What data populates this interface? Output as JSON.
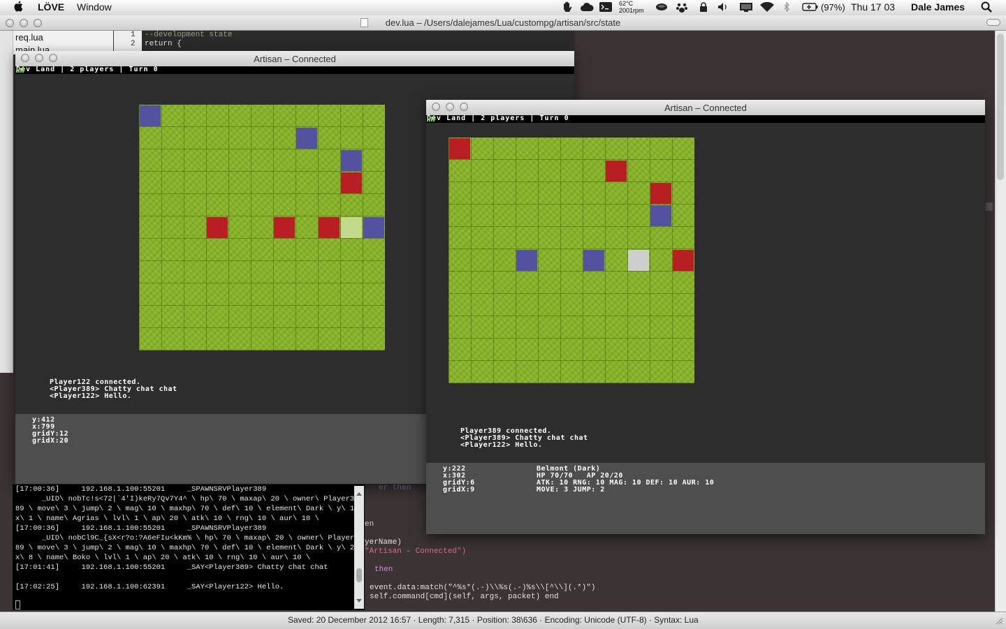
{
  "menubar": {
    "app": "LÖVE",
    "menu_window": "Window",
    "temp": "62°C",
    "rpm": "2001rpm",
    "battery": "(97%)",
    "clock": "Thu 17 03",
    "user": "Dale James"
  },
  "editor": {
    "title": "dev.lua – /Users/dalejames/Lua/custompg/artisan/src/state",
    "files": [
      "req.lua",
      "main.lua"
    ],
    "line_numbers": [
      "1",
      "2"
    ],
    "code_top": [
      "--development state",
      "return {"
    ],
    "code_bottom": [
      {
        "text": "er then",
        "color": "#7b6fa6"
      },
      {
        "text": "en",
        "color": "#cfcfcf"
      },
      {
        "text": "yerName)",
        "color": "#e0e0e0"
      },
      {
        "text": "\"Artisan – Connected\")",
        "color": "#e06c8c"
      },
      {
        "text": "then",
        "color": "#cf8cd6"
      },
      {
        "text": "event.data:match(\"^%s*(.-)\\\\%s(.-)%s\\\\[^\\\\](.*)\")",
        "color": "#e0e0e0"
      },
      {
        "text": "self.command[cmd](self, args, packet) end",
        "color": "#e0e0e0"
      }
    ],
    "status": "Saved: 20 December 2012 16:57  ·  Length: 7,315  ·  Position: 38\\636  ·  Encoding: Unicode (UTF-8)  ·  Syntax: Lua"
  },
  "windows": [
    {
      "title": "Artisan – Connected",
      "hud": "Dev Land | 2 players | Turn 0",
      "chat": [
        "Player122 connected.",
        "<Player389> Chatty chat chat",
        "<Player122> Hello."
      ],
      "info_left": [
        "y:412",
        "x:799",
        "gridY:12",
        "gridX:20"
      ],
      "info_right": [],
      "units": [
        {
          "col": 0,
          "row": 0,
          "kind": "blue"
        },
        {
          "col": 7,
          "row": 1,
          "kind": "blue"
        },
        {
          "col": 9,
          "row": 2,
          "kind": "blue"
        },
        {
          "col": 9,
          "row": 3,
          "kind": "red"
        },
        {
          "col": 3,
          "row": 5,
          "kind": "red"
        },
        {
          "col": 6,
          "row": 5,
          "kind": "red"
        },
        {
          "col": 8,
          "row": 5,
          "kind": "red"
        },
        {
          "col": 9,
          "row": 5,
          "kind": "highlight"
        },
        {
          "col": 10,
          "row": 5,
          "kind": "blue"
        }
      ]
    },
    {
      "title": "Artisan – Connected",
      "hud": "Dev Land | 2 players | Turn 0",
      "chat": [
        "Player389 connected.",
        "<Player389> Chatty chat chat",
        "<Player122> Hello."
      ],
      "info_left": [
        "y:222",
        "x:302",
        "gridY:6",
        "gridX:9"
      ],
      "info_right": [
        "Belmont (Dark)",
        "HP 70/70   AP 20/20",
        "ATK: 10 RNG: 10 MAG: 10 DEF: 10 AUR: 10",
        "MOVE: 3 JUMP: 2"
      ],
      "units": [
        {
          "col": 0,
          "row": 0,
          "kind": "red"
        },
        {
          "col": 7,
          "row": 1,
          "kind": "red"
        },
        {
          "col": 9,
          "row": 2,
          "kind": "red"
        },
        {
          "col": 9,
          "row": 3,
          "kind": "blue"
        },
        {
          "col": 3,
          "row": 5,
          "kind": "blue"
        },
        {
          "col": 6,
          "row": 5,
          "kind": "blue"
        },
        {
          "col": 8,
          "row": 5,
          "kind": "selected"
        },
        {
          "col": 10,
          "row": 5,
          "kind": "red"
        }
      ]
    }
  ],
  "unit_colors": {
    "red": "#b81e22",
    "blue": "#5452a0",
    "highlight": "#c3da8c",
    "selected": "#cfcfcf"
  },
  "terminal": [
    "[17:00:36]     192.168.1.100:55201     _SPAWNSRVPlayer389",
    "      _UID\\ nobTc!s<72|`4'I)keRy7Qv7Y4^ \\ hp\\ 70 \\ maxap\\ 20 \\ owner\\ Player3",
    "89 \\ move\\ 3 \\ jump\\ 2 \\ mag\\ 10 \\ maxhp\\ 70 \\ def\\ 10 \\ element\\ Dark \\ y\\ 1 \\",
    "x\\ 1 \\ name\\ Agrias \\ lvl\\ 1 \\ ap\\ 20 \\ atk\\ 10 \\ rng\\ 10 \\ aur\\ 10 \\",
    "[17:00:36]     192.168.1.100:55201     _SPAWNSRVPlayer389",
    "      _UID\\ nobCl9C_{sX<r?o:?A6eFIu<kKm% \\ hp\\ 70 \\ maxap\\ 20 \\ owner\\ Player3",
    "89 \\ move\\ 3 \\ jump\\ 2 \\ mag\\ 10 \\ maxhp\\ 70 \\ def\\ 10 \\ element\\ Dark \\ y\\ 2 \\",
    "x\\ 8 \\ name\\ Boko \\ lvl\\ 1 \\ ap\\ 20 \\ atk\\ 10 \\ rng\\ 10 \\ aur\\ 10 \\",
    "[17:01:41]     192.168.1.100:55201     _SAY<Player389> Chatty chat chat",
    "",
    "[17:02:25]     192.168.1.100:62391     _SAY<Player122> Hello."
  ]
}
